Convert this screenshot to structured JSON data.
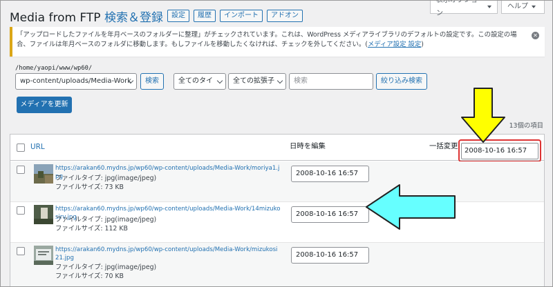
{
  "header": {
    "title_plain": "Media from FTP ",
    "title_accent": "検索＆登録",
    "buttons": [
      "設定",
      "履歴",
      "インポート",
      "アドオン"
    ],
    "screen_options": "表示オプション",
    "help": "ヘルプ"
  },
  "notice": {
    "text": "「アップロードしたファイルを年月ベースのフォルダーに整理」がチェックされています。これは、WordPress メディアライブラリのデフォルトの設定です。この設定の場合、ファイルは年月ベースのフォルダに移動します。もしファイルを移動したくなければ、チェックを外してください。(",
    "link": "メディア設定",
    "link_suffix": " 設定",
    "text_end": ")"
  },
  "filter": {
    "path": "/home/yaopi/www/wp60/",
    "folder_value": "wp-content/uploads/Media-Work",
    "search_button": "検索",
    "type_select": "全てのタイ",
    "ext_select": "全ての拡張子",
    "search_placeholder": "検索",
    "filter_button": "絞り込み検索"
  },
  "update_button": "メディアを更新",
  "item_count": "13個の項目",
  "table": {
    "col_url": "URL",
    "col_date": "日時を編集",
    "col_bulk": "一括変更",
    "bulk_value": "2008-10-16 16:57",
    "rows": [
      {
        "url": "https://arakan60.mydns.jp/wp60/wp-content/uploads/Media-Work/moriya1.jpg",
        "file_type": "ファイルタイプ: jpg(image/jpeg)",
        "file_size": "ファイルサイズ: 73 KB",
        "date": "2008-10-16 16:57"
      },
      {
        "url": "https://arakan60.mydns.jp/wp60/wp-content/uploads/Media-Work/14mizukosirv.jpg",
        "file_type": "ファイルタイプ: jpg(image/jpeg)",
        "file_size": "ファイルサイズ: 112 KB",
        "date": "2008-10-16 16:57"
      },
      {
        "url": "https://arakan60.mydns.jp/wp60/wp-content/uploads/Media-Work/mizukosi21.jpg",
        "file_type": "ファイルタイプ: jpg(image/jpeg)",
        "file_size": "ファイルサイズ: 70 KB",
        "date": "2008-10-16 16:57"
      }
    ]
  },
  "colors": {
    "accent": "#2271b1",
    "notice_border": "#dba617",
    "highlight_ring": "#dd3333",
    "yellow_arrow": "#ffff00",
    "cyan_arrow": "#66ffff"
  }
}
